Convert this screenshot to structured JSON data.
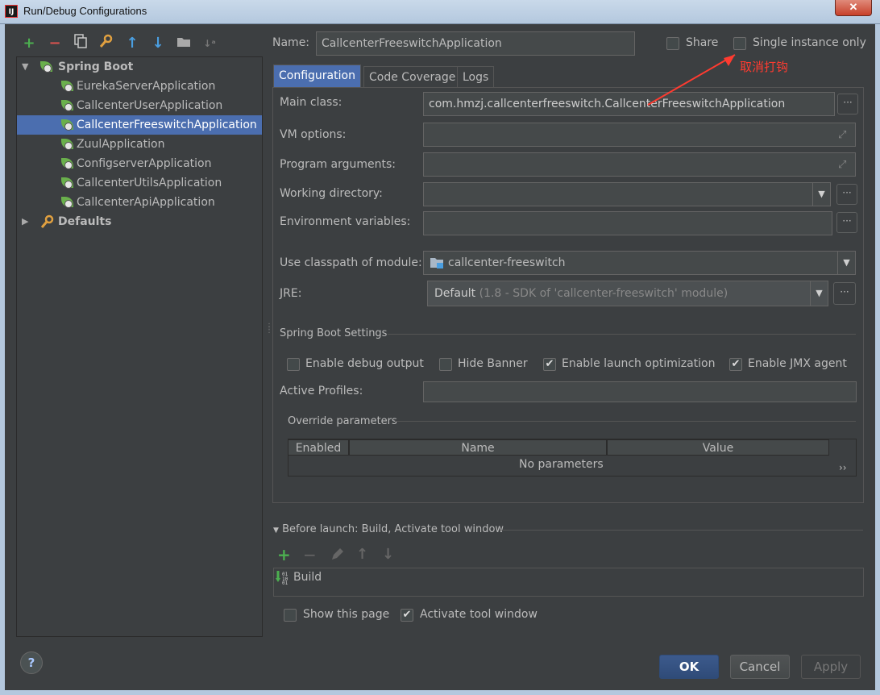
{
  "window": {
    "title": "Run/Debug Configurations",
    "close_label": "✕"
  },
  "tree": {
    "group": "Spring Boot",
    "items": [
      "EurekaServerApplication",
      "CallcenterUserApplication",
      "CallcenterFreeswitchApplication",
      "ZuulApplication",
      "ConfigserverApplication",
      "CallcenterUtilsApplication",
      "CallcenterApiApplication"
    ],
    "defaults": "Defaults"
  },
  "header": {
    "name_label": "Name:",
    "name_value": "CallcenterFreeswitchApplication",
    "share_label": "Share",
    "single_instance_label": "Single instance only",
    "annotation": "取消打钩"
  },
  "tabs": [
    "Configuration",
    "Code Coverage",
    "Logs"
  ],
  "form": {
    "main_class_label": "Main class:",
    "main_class_value": "com.hmzj.callcenterfreeswitch.CallcenterFreeswitchApplication",
    "vm_options_label": "VM options:",
    "program_args_label": "Program arguments:",
    "working_dir_label": "Working directory:",
    "env_vars_label": "Environment variables:",
    "classpath_label": "Use classpath of module:",
    "classpath_value": "callcenter-freeswitch",
    "jre_label": "JRE:",
    "jre_value": "Default",
    "jre_hint": "(1.8 - SDK of 'callcenter-freeswitch' module)",
    "more": "···"
  },
  "spring_boot_settings": {
    "title": "Spring Boot Settings",
    "debug_output": "Enable debug output",
    "hide_banner": "Hide Banner",
    "launch_opt": "Enable launch optimization",
    "jmx": "Enable JMX agent",
    "active_profiles_label": "Active Profiles:"
  },
  "override": {
    "title": "Override parameters",
    "columns": [
      "Enabled",
      "Name",
      "Value"
    ],
    "empty": "No parameters",
    "more": "››"
  },
  "before_launch": {
    "title": "Before launch: Build, Activate tool window",
    "item": "Build",
    "show_page": "Show this page",
    "activate_tool": "Activate tool window"
  },
  "buttons": {
    "help": "?",
    "ok": "OK",
    "cancel": "Cancel",
    "apply": "Apply"
  }
}
